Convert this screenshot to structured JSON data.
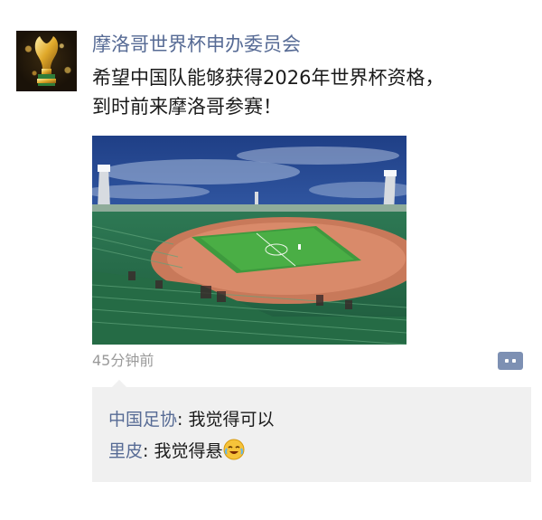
{
  "post": {
    "author": "摩洛哥世界杯申办委员会",
    "content_lines": [
      "希望中国队能够获得2026年世界杯资格，",
      "到时前来摩洛哥参赛！"
    ],
    "timestamp": "45分钟前",
    "avatar_icon": "world-cup-trophy",
    "photo_subject": "stadium"
  },
  "actions": {
    "more_icon": "comment-dots-icon"
  },
  "comments": [
    {
      "author": "中国足协",
      "separator": ": ",
      "text": "我觉得可以"
    },
    {
      "author": "里皮",
      "separator": ": ",
      "text": "我觉得悬",
      "emoji": "laughing-crying"
    }
  ],
  "colors": {
    "name_link": "#576b95",
    "text": "#1a1a1a",
    "muted": "#9a9a9a",
    "comment_bg": "#f0f0f0",
    "action_button": "#7d90b3"
  }
}
